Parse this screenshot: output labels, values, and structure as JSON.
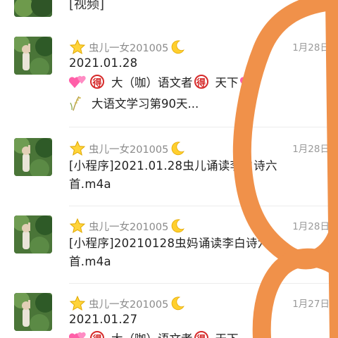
{
  "top_partial": {
    "text": "[视频]"
  },
  "messages": [
    {
      "sender": "虫儿一女201005",
      "time": "1月28日",
      "line1": "2021.01.28",
      "line2_parts": [
        "大（咖）语文者",
        "天下"
      ],
      "circled_char": "得",
      "line3": "大语文学习第90天..."
    },
    {
      "sender": "虫儿一女201005",
      "time": "1月28日",
      "line1": "[小程序]2021.01.28虫儿诵读李白诗六",
      "line2": "首.m4a"
    },
    {
      "sender": "虫儿一女201005",
      "time": "1月28日",
      "line1": "[小程序]20210128虫妈诵读李白诗六",
      "line2": "首.m4a"
    },
    {
      "sender": "虫儿一女201005",
      "time": "1月27日",
      "line1": "2021.01.27",
      "line2_parts": [
        "大（咖）语文者",
        "天下"
      ],
      "circled_char": "得"
    }
  ],
  "colors": {
    "scribble": "#f0914a",
    "circled": "#d62a2a",
    "name": "#8a8a8a",
    "time": "#9a9a9a"
  }
}
